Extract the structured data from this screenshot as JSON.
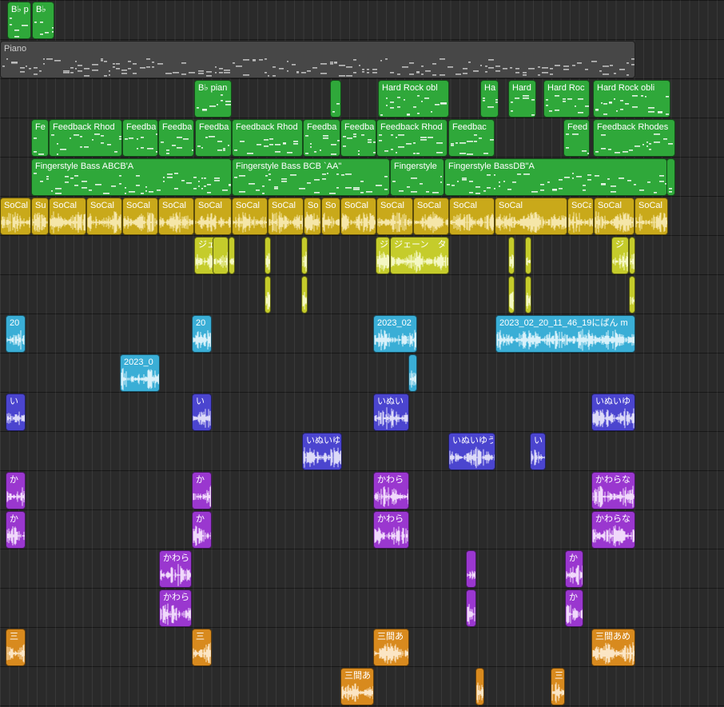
{
  "colors": {
    "midi_green": "#2fa83a",
    "midi_green_light": "#e6f5e6",
    "piano_grey": "#474747",
    "piano_grey_light": "#bdbdbd",
    "socal_yellow": "#c9a91a",
    "socal_yellow_light": "#f5e6a8",
    "jane_yellow": "#c5cc2b",
    "jane_yellow_light": "#f4f7c2",
    "rec_cyan": "#3aaed6",
    "rec_cyan_light": "#d8f1fa",
    "inu_blue": "#4b45cf",
    "inu_blue_light": "#dcdaf8",
    "kawara_purple": "#9a37cf",
    "kawara_purple_light": "#f0d8fb",
    "sanken_orange": "#d88a1e",
    "sanken_orange_light": "#fbe5c4"
  },
  "tracks": [
    {
      "id": "track-bflat-piano-top",
      "type": "midi",
      "color": "midi_green",
      "regions": [
        {
          "name": "B♭ p"
        },
        {
          "name": "B♭"
        }
      ]
    },
    {
      "id": "track-piano",
      "type": "midi-grey",
      "color": "piano_grey",
      "regions": [
        {
          "name": "Piano"
        }
      ]
    },
    {
      "id": "track-hard-rock",
      "type": "midi",
      "color": "midi_green",
      "regions": [
        {
          "name": "B♭ pian"
        },
        {
          "name": ""
        },
        {
          "name": "Hard Rock   obl"
        },
        {
          "name": "Ha"
        },
        {
          "name": "Hard"
        },
        {
          "name": "Hard Roc"
        },
        {
          "name": "Hard Rock   obli"
        }
      ]
    },
    {
      "id": "track-feedback-rhodes",
      "type": "midi",
      "color": "midi_green",
      "regions": [
        {
          "name": "Fe"
        },
        {
          "name": "Feedback Rhod"
        },
        {
          "name": "Feedba"
        },
        {
          "name": "Feedba"
        },
        {
          "name": "Feedba"
        },
        {
          "name": "Feedback Rhod"
        },
        {
          "name": "Feedba"
        },
        {
          "name": "Feedba"
        },
        {
          "name": "Feedback Rhod"
        },
        {
          "name": "Feedbac"
        },
        {
          "name": "Feed"
        },
        {
          "name": "Feedback Rhodes"
        }
      ]
    },
    {
      "id": "track-fingerstyle-bass",
      "type": "midi",
      "color": "midi_green",
      "regions": [
        {
          "name": "Fingerstyle Bass   ABCB'A"
        },
        {
          "name": "Fingerstyle Bass   BCB `AA\""
        },
        {
          "name": "Fingerstyle"
        },
        {
          "name": "Fingerstyle BassDB\"A"
        },
        {
          "name": ""
        }
      ]
    },
    {
      "id": "track-socal",
      "type": "audio",
      "color": "socal_yellow",
      "regions": [
        {
          "name": "SoCal"
        },
        {
          "name": "Su"
        },
        {
          "name": "SoCal"
        },
        {
          "name": "SoCal"
        },
        {
          "name": "SoCal"
        },
        {
          "name": "SoCal"
        },
        {
          "name": "SoCal"
        },
        {
          "name": "SoCal"
        },
        {
          "name": "SoCal"
        },
        {
          "name": "So"
        },
        {
          "name": "So"
        },
        {
          "name": "SoCal"
        },
        {
          "name": "SoCal"
        },
        {
          "name": "SoCal"
        },
        {
          "name": "SoCal"
        },
        {
          "name": "SoCal"
        },
        {
          "name": "SoCa"
        },
        {
          "name": "SoCal"
        },
        {
          "name": "SoCal"
        }
      ]
    },
    {
      "id": "track-jane-1",
      "type": "audio",
      "color": "jane_yellow",
      "regions": [
        {
          "name": "ジェー"
        },
        {
          "name": ""
        },
        {
          "name": ""
        },
        {
          "name": ""
        },
        {
          "name": ""
        },
        {
          "name": "ジ"
        },
        {
          "name": "ジェーン　タ"
        },
        {
          "name": ""
        },
        {
          "name": ""
        },
        {
          "name": "ジ"
        },
        {
          "name": ""
        }
      ]
    },
    {
      "id": "track-jane-2",
      "type": "audio",
      "color": "jane_yellow",
      "regions": [
        {
          "name": ""
        },
        {
          "name": ""
        },
        {
          "name": ""
        },
        {
          "name": ""
        },
        {
          "name": ""
        }
      ]
    },
    {
      "id": "track-recording-1",
      "type": "audio",
      "color": "rec_cyan",
      "regions": [
        {
          "name": "20"
        },
        {
          "name": "20"
        },
        {
          "name": "2023_02"
        },
        {
          "name": "2023_02_20_11_46_19にぱん m"
        }
      ]
    },
    {
      "id": "track-recording-2",
      "type": "audio",
      "color": "rec_cyan",
      "regions": [
        {
          "name": "2023_0"
        },
        {
          "name": ""
        }
      ]
    },
    {
      "id": "track-inu-1",
      "type": "audio",
      "color": "inu_blue",
      "regions": [
        {
          "name": "い"
        },
        {
          "name": "い"
        },
        {
          "name": "いぬい"
        },
        {
          "name": "いぬいゆ"
        }
      ]
    },
    {
      "id": "track-inu-2",
      "type": "audio",
      "color": "inu_blue",
      "regions": [
        {
          "name": "いぬいゆ"
        },
        {
          "name": "いぬいゆう"
        },
        {
          "name": "い"
        }
      ]
    },
    {
      "id": "track-kawara-1",
      "type": "audio",
      "color": "kawara_purple",
      "regions": [
        {
          "name": "か"
        },
        {
          "name": "か"
        },
        {
          "name": "かわら"
        },
        {
          "name": "かわらな"
        }
      ]
    },
    {
      "id": "track-kawara-2",
      "type": "audio",
      "color": "kawara_purple",
      "regions": [
        {
          "name": "か"
        },
        {
          "name": "か"
        },
        {
          "name": "かわら"
        },
        {
          "name": "かわらな"
        }
      ]
    },
    {
      "id": "track-kawara-3",
      "type": "audio",
      "color": "kawara_purple",
      "regions": [
        {
          "name": "かわら"
        },
        {
          "name": ""
        },
        {
          "name": "か"
        }
      ]
    },
    {
      "id": "track-kawara-4",
      "type": "audio",
      "color": "kawara_purple",
      "regions": [
        {
          "name": "かわら"
        },
        {
          "name": ""
        },
        {
          "name": "か"
        }
      ]
    },
    {
      "id": "track-sanken-1",
      "type": "audio",
      "color": "sanken_orange",
      "regions": [
        {
          "name": "三"
        },
        {
          "name": "三"
        },
        {
          "name": "三間あ"
        },
        {
          "name": "三間あめ"
        }
      ]
    },
    {
      "id": "track-sanken-2",
      "type": "audio",
      "color": "sanken_orange",
      "regions": [
        {
          "name": "三間あ"
        },
        {
          "name": ""
        },
        {
          "name": "三"
        }
      ]
    }
  ]
}
